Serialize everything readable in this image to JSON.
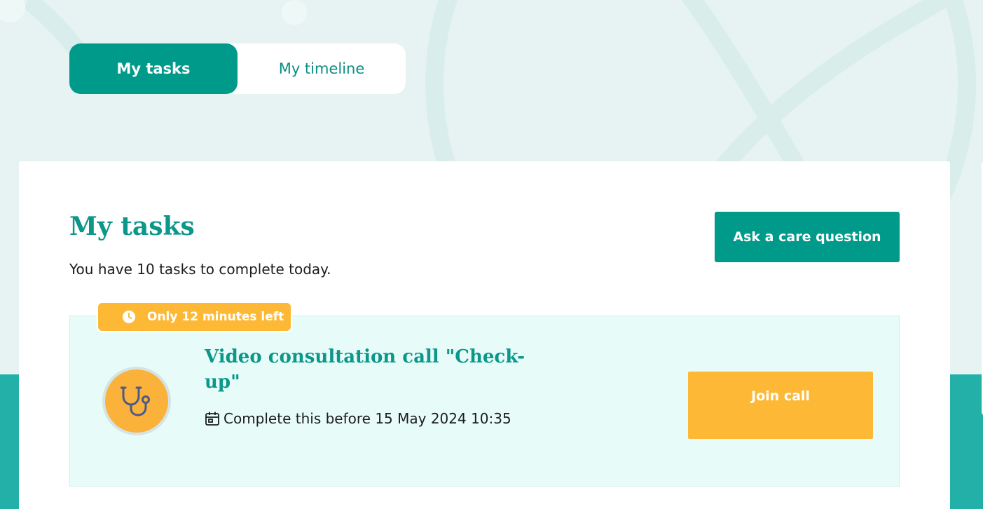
{
  "tabs": [
    {
      "label": "My tasks",
      "active": true
    },
    {
      "label": "My timeline",
      "active": false
    }
  ],
  "page": {
    "title": "My tasks",
    "subtitle": "You have 10 tasks to complete today.",
    "ask_button": "Ask a care question"
  },
  "task": {
    "badge": "Only 12 minutes left",
    "badge_icon": "clock-icon",
    "avatar_icon": "stethoscope-icon",
    "title": "Video consultation call \"Check-up\"",
    "due_icon": "calendar-icon",
    "due": "Complete this before 15 May 2024 10:35",
    "join_button": "Join call"
  },
  "colors": {
    "primary": "#009a8a",
    "accent": "#fdb936",
    "task_background": "#e7fcf9",
    "band": "#23b0a9"
  }
}
